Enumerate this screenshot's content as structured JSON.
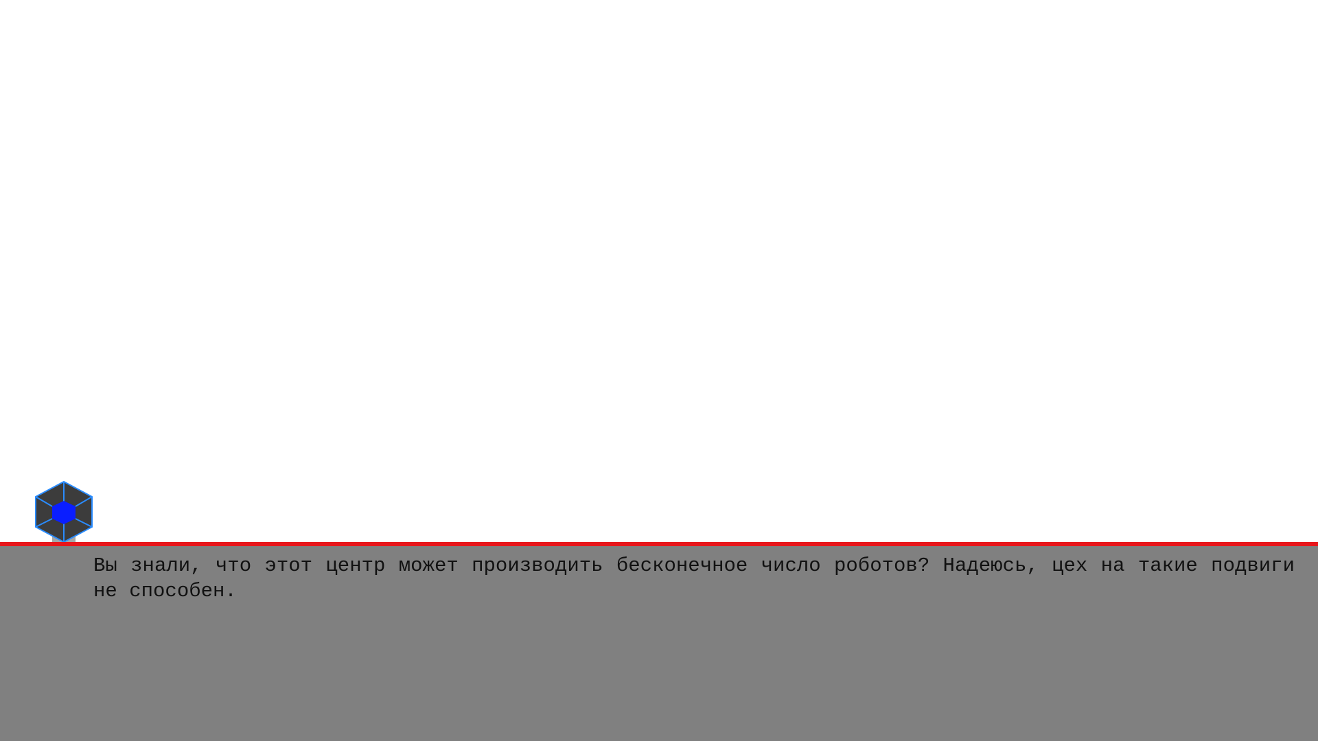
{
  "dialog": {
    "text": "Вы знали, что этот центр может производить бесконечное число роботов? Надеюсь, цех на такие подвиги не способен."
  },
  "colors": {
    "scene_background": "#ffffff",
    "dialog_background": "#808080",
    "divider": "#e8161b",
    "text": "#111111",
    "portrait_body": "#3c3c3c",
    "portrait_edges": "#2a8cff",
    "portrait_core": "#0a1eff"
  },
  "speaker": {
    "icon": "robot-center-hexagon-icon"
  }
}
